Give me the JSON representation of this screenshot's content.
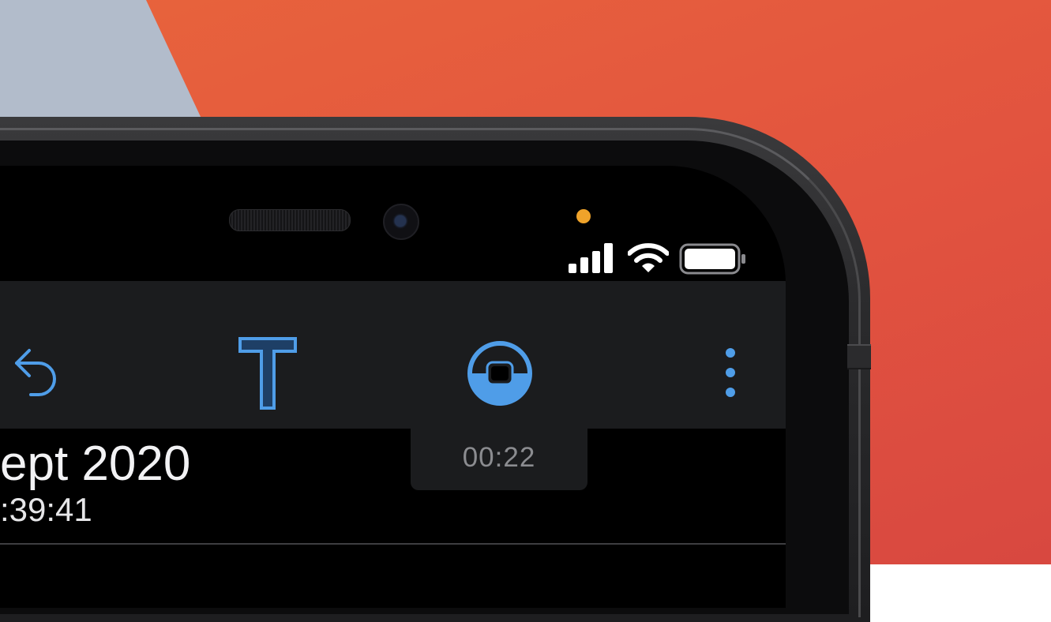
{
  "toolbar": {
    "undo_icon": "undo-arrow-icon",
    "text_icon": "text-tool-icon",
    "record_icon": "record-stop-icon",
    "more_icon": "vertical-ellipsis-icon",
    "accent_color": "#4f9de8"
  },
  "status_bar": {
    "signal_icon": "cellular-signal-icon",
    "wifi_icon": "wifi-icon",
    "battery_icon": "battery-full-icon",
    "privacy_indicator_color": "#f0a32a"
  },
  "recording": {
    "elapsed": "00:22"
  },
  "note": {
    "date_fragment": "ept 2020",
    "time_fragment": ":39:41"
  }
}
